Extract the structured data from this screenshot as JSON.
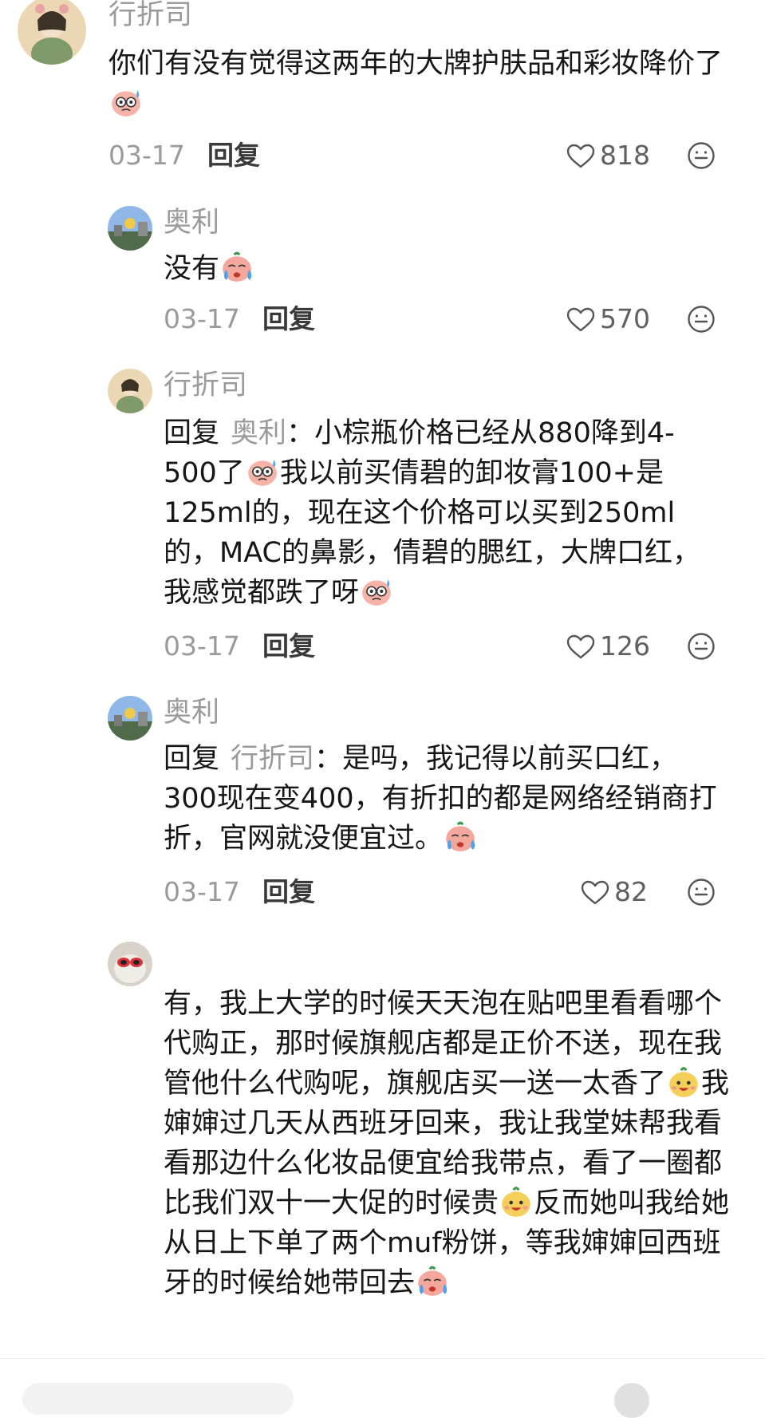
{
  "colors": {
    "username": "#9a9a9a",
    "text": "#161616",
    "meta": "#9a9a9a"
  },
  "icons": {
    "like": "heart-outline-icon",
    "more": "more-circle-icon"
  },
  "comments": [
    {
      "username": "行折司",
      "text_a": "你们有没有觉得这两年的大牌护肤品和彩妆降价了",
      "emoji_1": "sweat-face-emoji",
      "date": "03-17",
      "reply_label": "回复",
      "likes": "818"
    },
    {
      "username": "奥利",
      "text_a": "没有",
      "emoji_1": "crying-face-emoji",
      "date": "03-17",
      "reply_label": "回复",
      "likes": "570"
    },
    {
      "username": "行折司",
      "reply_prefix": "回复",
      "reply_target": "奥利",
      "text_a": "：小棕瓶价格已经从880降到4-500了",
      "emoji_1": "sweat-face-emoji",
      "text_b": "我以前买倩碧的卸妆膏100+是125ml的，现在这个价格可以买到250ml的，MAC的鼻影，倩碧的腮红，大牌口红，我感觉都跌了呀",
      "emoji_2": "sweat-face-emoji",
      "date": "03-17",
      "reply_label": "回复",
      "likes": "126"
    },
    {
      "username": "奥利",
      "reply_prefix": "回复",
      "reply_target": "行折司",
      "text_a": "：是吗，我记得以前买口红，300现在变400，有折扣的都是网络经销商打折，官网就没便宜过。",
      "emoji_1": "crying-face-emoji",
      "date": "03-17",
      "reply_label": "回复",
      "likes": "82"
    },
    {
      "text_a": "有，我上大学的时候天天泡在贴吧里看看哪个代购正，那时候旗舰店都是正价不送，现在我管他什么代购呢，旗舰店买一送一太香了",
      "emoji_1": "happy-face-emoji",
      "text_b": "我婶婶过几天从西班牙回来，我让我堂妹帮我看看那边什么化妆品便宜给我带点，看了一圈都比我们双十一大促的时候贵",
      "emoji_2": "happy-face-emoji",
      "text_c": "反而她叫我给她从日上下单了两个muf粉饼，等我婶婶回西班牙的时候给她带回去",
      "emoji_3": "crying-face-emoji"
    }
  ]
}
